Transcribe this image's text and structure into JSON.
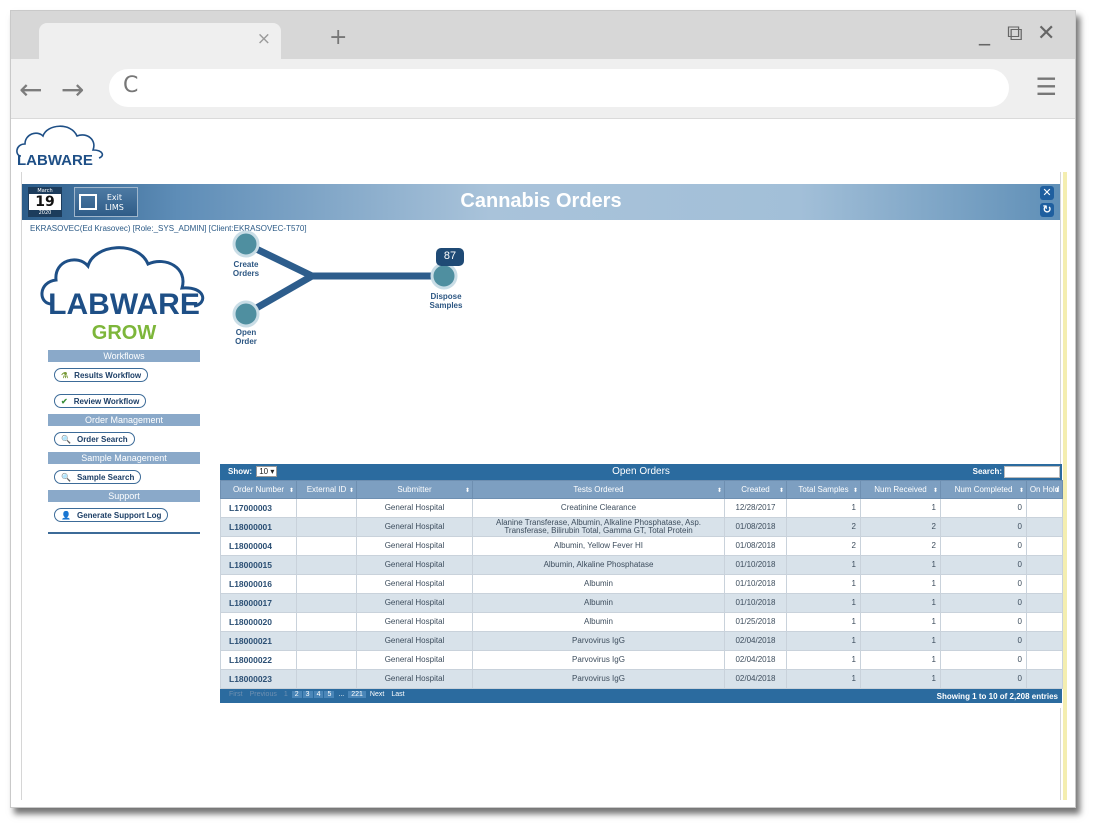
{
  "browser": {
    "tab_close": "×",
    "new_tab": "+",
    "minimize": "_",
    "restore": "⧉",
    "close": "✕",
    "back": "←",
    "forward": "→",
    "reload": "C",
    "menu": "☰"
  },
  "logo_text": "LABWARE",
  "header": {
    "calendar": {
      "month": "March",
      "day": "19",
      "year": "2020"
    },
    "exit_label_1": "Exit",
    "exit_label_2": "LIMS",
    "title": "Cannabis Orders",
    "user_line": "EKRASOVEC(Ed Krasovec) [Role:_SYS_ADMIN] [Client:EKRASOVEC-T570]"
  },
  "brand": {
    "main": "LABWARE",
    "sub": "GROW"
  },
  "sidebar": {
    "sections": [
      {
        "title": "Workflows",
        "items": [
          "Results Workflow",
          "Review Workflow"
        ]
      },
      {
        "title": "Order Management",
        "items": [
          "Order Search"
        ]
      },
      {
        "title": "Sample Management",
        "items": [
          "Sample Search"
        ]
      },
      {
        "title": "Support",
        "items": [
          "Generate Support Log"
        ]
      }
    ]
  },
  "flow": {
    "create_1": "Create",
    "create_2": "Orders",
    "open_1": "Open",
    "open_2": "Order",
    "dispose_1": "Dispose",
    "dispose_2": "Samples",
    "badge": "87"
  },
  "grid": {
    "show_label": "Show:",
    "show_value": "10",
    "title": "Open Orders",
    "search_label": "Search:",
    "columns": [
      "Order Number",
      "External ID",
      "Submitter",
      "Tests Ordered",
      "Created",
      "Total Samples",
      "Num Received",
      "Num Completed",
      "On Hold"
    ],
    "rows": [
      [
        "L17000003",
        "",
        "General Hospital",
        "Creatinine Clearance",
        "12/28/2017",
        "1",
        "1",
        "0",
        ""
      ],
      [
        "L18000001",
        "",
        "General Hospital",
        "Alanine Transferase, Albumin, Alkaline Phosphatase, Asp. Transferase, Bilirubin Total, Gamma GT, Total Protein",
        "01/08/2018",
        "2",
        "2",
        "0",
        ""
      ],
      [
        "L18000004",
        "",
        "General Hospital",
        "Albumin, Yellow Fever HI",
        "01/08/2018",
        "2",
        "2",
        "0",
        ""
      ],
      [
        "L18000015",
        "",
        "General Hospital",
        "Albumin, Alkaline Phosphatase",
        "01/10/2018",
        "1",
        "1",
        "0",
        ""
      ],
      [
        "L18000016",
        "",
        "General Hospital",
        "Albumin",
        "01/10/2018",
        "1",
        "1",
        "0",
        ""
      ],
      [
        "L18000017",
        "",
        "General Hospital",
        "Albumin",
        "01/10/2018",
        "1",
        "1",
        "0",
        ""
      ],
      [
        "L18000020",
        "",
        "General Hospital",
        "Albumin",
        "01/25/2018",
        "1",
        "1",
        "0",
        ""
      ],
      [
        "L18000021",
        "",
        "General Hospital",
        "Parvovirus IgG",
        "02/04/2018",
        "1",
        "1",
        "0",
        ""
      ],
      [
        "L18000022",
        "",
        "General Hospital",
        "Parvovirus IgG",
        "02/04/2018",
        "1",
        "1",
        "0",
        ""
      ],
      [
        "L18000023",
        "",
        "General Hospital",
        "Parvovirus IgG",
        "02/04/2018",
        "1",
        "1",
        "0",
        ""
      ]
    ],
    "pager": [
      "First",
      "Previous",
      "1",
      "2",
      "3",
      "4",
      "5",
      "...",
      "221",
      "Next",
      "Last"
    ],
    "showing": "Showing 1 to 10 of 2,208 entries"
  }
}
